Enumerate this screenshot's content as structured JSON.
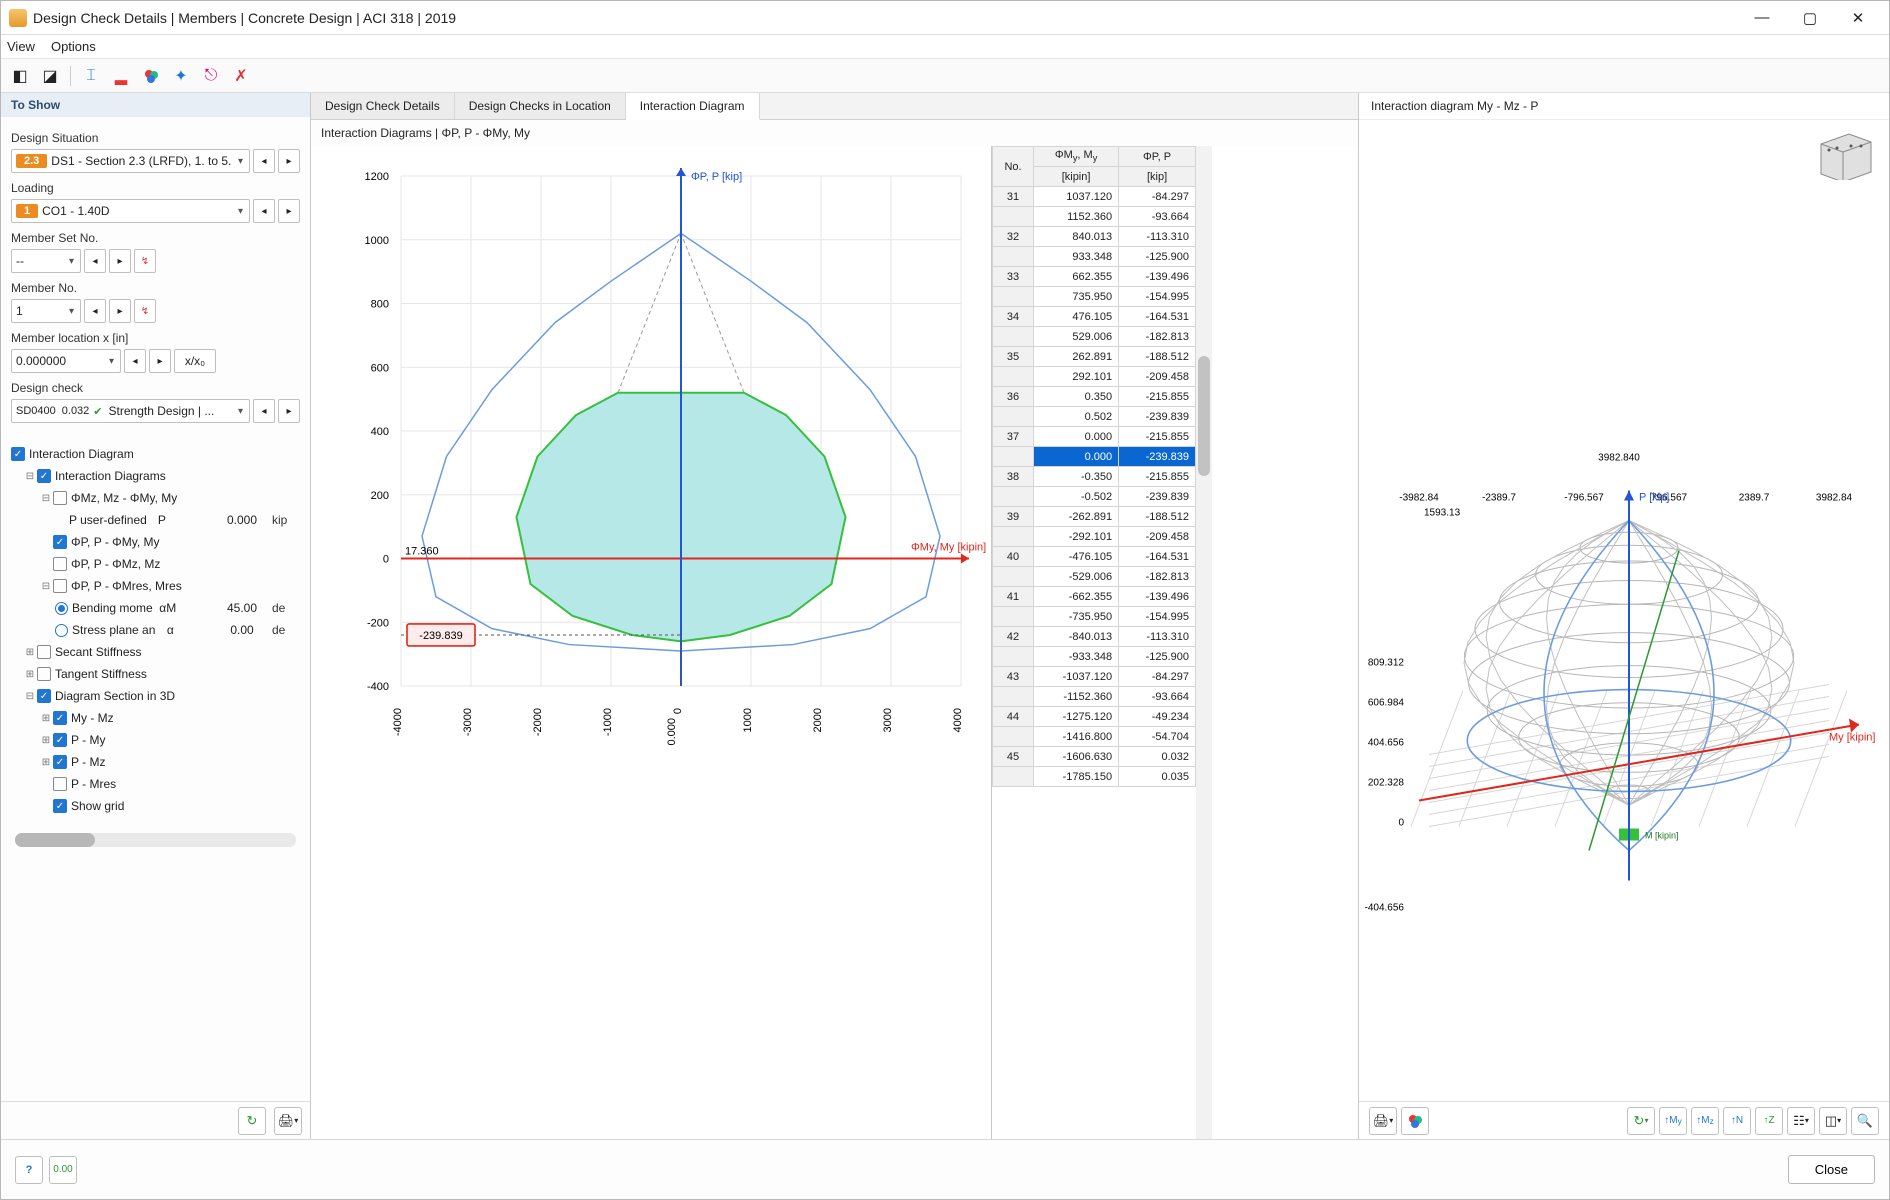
{
  "window": {
    "title": "Design Check Details | Members | Concrete Design | ACI 318 | 2019"
  },
  "menu": {
    "view": "View",
    "options": "Options"
  },
  "sidebar": {
    "header": "To Show",
    "design_situation_label": "Design Situation",
    "design_situation_badge": "2.3",
    "design_situation_value": "DS1 - Section 2.3 (LRFD), 1. to 5.",
    "loading_label": "Loading",
    "loading_badge": "1",
    "loading_value": "CO1 - 1.40D",
    "member_set_label": "Member Set No.",
    "member_set_value": "--",
    "member_no_label": "Member No.",
    "member_no_value": "1",
    "member_loc_label": "Member location x [in]",
    "member_loc_value": "0.000000",
    "member_loc_btn": "x/x₀",
    "design_check_label": "Design check",
    "design_check_code": "SD0400",
    "design_check_val": "0.032",
    "design_check_text": "Strength Design | ...",
    "tree": {
      "root": "Interaction Diagram",
      "diagrams": "Interaction Diagrams",
      "mz_my": "ΦMz, Mz - ΦMy, My",
      "p_user": "P user-defined",
      "p_user_sym": "P",
      "p_user_val": "0.000",
      "p_user_unit": "kip",
      "pp_my": "ΦP, P - ΦMy, My",
      "pp_mz": "ΦP, P - ΦMz, Mz",
      "pp_mres": "ΦP, P - ΦMres, Mres",
      "bend": "Bending mome",
      "bend_sym": "αM",
      "bend_val": "45.00",
      "bend_unit": "de",
      "stress": "Stress plane an",
      "stress_sym": "α",
      "stress_val": "0.00",
      "stress_unit": "de",
      "secant": "Secant Stiffness",
      "tangent": "Tangent Stiffness",
      "section3d": "Diagram Section in 3D",
      "mymz": "My - Mz",
      "pmy": "P - My",
      "pmz": "P - Mz",
      "pmres": "P - Mres",
      "showgrid": "Show grid"
    }
  },
  "tabs": {
    "t1": "Design Check Details",
    "t2": "Design Checks in Location",
    "t3": "Interaction Diagram"
  },
  "chart_title_2d": "Interaction Diagrams | ΦP, P - ΦMy, My",
  "chart_title_3d": "Interaction diagram My - Mz - P",
  "chart_data": [
    {
      "type": "line",
      "title": "Interaction Diagrams | ΦP, P - ΦMy, My",
      "xlabel": "ΦMy, My [kipin]",
      "ylabel": "ΦP, P [kip]",
      "xlim": [
        -4000,
        4000
      ],
      "ylim": [
        -400,
        1200
      ],
      "x_ticks": [
        -4000,
        -3000,
        -2000,
        -1000,
        0,
        1000,
        2000,
        3000,
        4000
      ],
      "y_ticks": [
        -400,
        -200,
        0,
        200,
        400,
        600,
        800,
        1000,
        1200
      ],
      "highlight_box": {
        "label": "-239.839",
        "y": -239.839,
        "x": -380
      },
      "highlight_xtick": "0.000",
      "y_marker_label": "17.360",
      "series": [
        {
          "name": "nominal envelope (blue)",
          "color": "#6b9ce0",
          "points": [
            [
              0,
              1020
            ],
            [
              1000,
              870
            ],
            [
              1800,
              740
            ],
            [
              2700,
              530
            ],
            [
              3350,
              320
            ],
            [
              3700,
              70
            ],
            [
              3500,
              -120
            ],
            [
              2700,
              -220
            ],
            [
              1600,
              -270
            ],
            [
              0,
              -290
            ],
            [
              -1600,
              -270
            ],
            [
              -2700,
              -220
            ],
            [
              -3500,
              -120
            ],
            [
              -3700,
              70
            ],
            [
              -3350,
              320
            ],
            [
              -2700,
              530
            ],
            [
              -1800,
              740
            ],
            [
              -1000,
              870
            ],
            [
              0,
              1020
            ]
          ]
        },
        {
          "name": "design envelope (green, filled)",
          "color": "#35c03d",
          "fill": "#b6e8e8",
          "points": [
            [
              -900,
              520
            ],
            [
              900,
              520
            ],
            [
              1500,
              450
            ],
            [
              2050,
              320
            ],
            [
              2350,
              130
            ],
            [
              2150,
              -80
            ],
            [
              1550,
              -180
            ],
            [
              700,
              -240
            ],
            [
              0,
              -260
            ],
            [
              -700,
              -240
            ],
            [
              -1550,
              -180
            ],
            [
              -2150,
              -80
            ],
            [
              -2350,
              130
            ],
            [
              -2050,
              320
            ],
            [
              -1500,
              450
            ],
            [
              -900,
              520
            ]
          ]
        }
      ]
    },
    {
      "type": "3d-surface",
      "title": "Interaction diagram My - Mz - P",
      "axes": {
        "x": "My [kipin]",
        "y": "Mz [kipin]",
        "z": "P [kip]"
      },
      "my_ticks": [
        -3982.84,
        -2389.7,
        -796.567,
        796.567,
        2389.7,
        3982.84
      ],
      "mz_ticks": [
        1593.13
      ],
      "p_ticks": [
        -404.656,
        0,
        202.328,
        404.656,
        606.984,
        809.312
      ],
      "top_label": "3982.840"
    }
  ],
  "table": {
    "col_no": "No.",
    "col_my": "ΦMy, My\n[kipin]",
    "col_p": "ΦP, P\n[kip]",
    "rows": [
      {
        "no": "31",
        "my": "1037.120",
        "p": "-84.297"
      },
      {
        "no": "",
        "my": "1152.360",
        "p": "-93.664"
      },
      {
        "no": "32",
        "my": "840.013",
        "p": "-113.310"
      },
      {
        "no": "",
        "my": "933.348",
        "p": "-125.900"
      },
      {
        "no": "33",
        "my": "662.355",
        "p": "-139.496"
      },
      {
        "no": "",
        "my": "735.950",
        "p": "-154.995"
      },
      {
        "no": "34",
        "my": "476.105",
        "p": "-164.531"
      },
      {
        "no": "",
        "my": "529.006",
        "p": "-182.813"
      },
      {
        "no": "35",
        "my": "262.891",
        "p": "-188.512"
      },
      {
        "no": "",
        "my": "292.101",
        "p": "-209.458"
      },
      {
        "no": "36",
        "my": "0.350",
        "p": "-215.855"
      },
      {
        "no": "",
        "my": "0.502",
        "p": "-239.839"
      },
      {
        "no": "37",
        "my": "0.000",
        "p": "-215.855"
      },
      {
        "no": "",
        "my": "0.000",
        "p": "-239.839",
        "sel": true
      },
      {
        "no": "38",
        "my": "-0.350",
        "p": "-215.855"
      },
      {
        "no": "",
        "my": "-0.502",
        "p": "-239.839"
      },
      {
        "no": "39",
        "my": "-262.891",
        "p": "-188.512"
      },
      {
        "no": "",
        "my": "-292.101",
        "p": "-209.458"
      },
      {
        "no": "40",
        "my": "-476.105",
        "p": "-164.531"
      },
      {
        "no": "",
        "my": "-529.006",
        "p": "-182.813"
      },
      {
        "no": "41",
        "my": "-662.355",
        "p": "-139.496"
      },
      {
        "no": "",
        "my": "-735.950",
        "p": "-154.995"
      },
      {
        "no": "42",
        "my": "-840.013",
        "p": "-113.310"
      },
      {
        "no": "",
        "my": "-933.348",
        "p": "-125.900"
      },
      {
        "no": "43",
        "my": "-1037.120",
        "p": "-84.297"
      },
      {
        "no": "",
        "my": "-1152.360",
        "p": "-93.664"
      },
      {
        "no": "44",
        "my": "-1275.120",
        "p": "-49.234"
      },
      {
        "no": "",
        "my": "-1416.800",
        "p": "-54.704"
      },
      {
        "no": "45",
        "my": "-1606.630",
        "p": "0.032"
      },
      {
        "no": "",
        "my": "-1785.150",
        "p": "0.035"
      }
    ]
  },
  "footer": {
    "close": "Close"
  }
}
